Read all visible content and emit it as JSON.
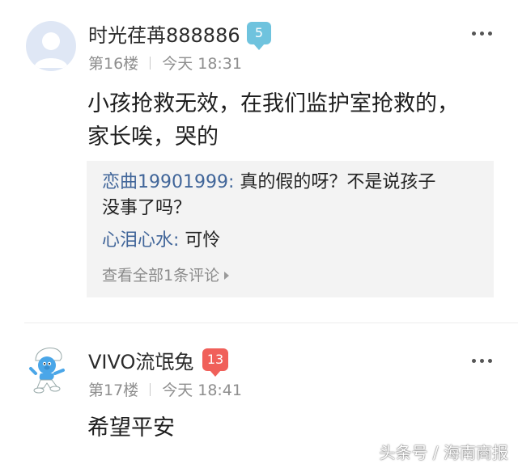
{
  "comments": [
    {
      "username": "时光荏苒888886",
      "level": "5",
      "level_color": "#6fc3de",
      "floor": "第16楼",
      "time": "今天 18:31",
      "avatar_icon": "default-user-avatar-icon",
      "text_line1": "小孩抢救无效，在我们监护室抢救的，",
      "text_line2": "家长唉，哭的",
      "replies": [
        {
          "name": "恋曲19901999:",
          "text_line1": " 真的假的呀？不是说孩子",
          "text_line2": "没事了吗？"
        },
        {
          "name": "心泪心水:",
          "text_line1": " 可怜"
        }
      ],
      "view_all": "查看全部1条评论"
    },
    {
      "username": "VIVO流氓兔",
      "level": "13",
      "level_color": "#f0605a",
      "floor": "第17楼",
      "time": "今天 18:41",
      "avatar_icon": "smurf-avatar-icon",
      "text_line1": "希望平安"
    }
  ],
  "more_icon": "more-dots-icon",
  "watermark": "头条号 / 海南商报"
}
